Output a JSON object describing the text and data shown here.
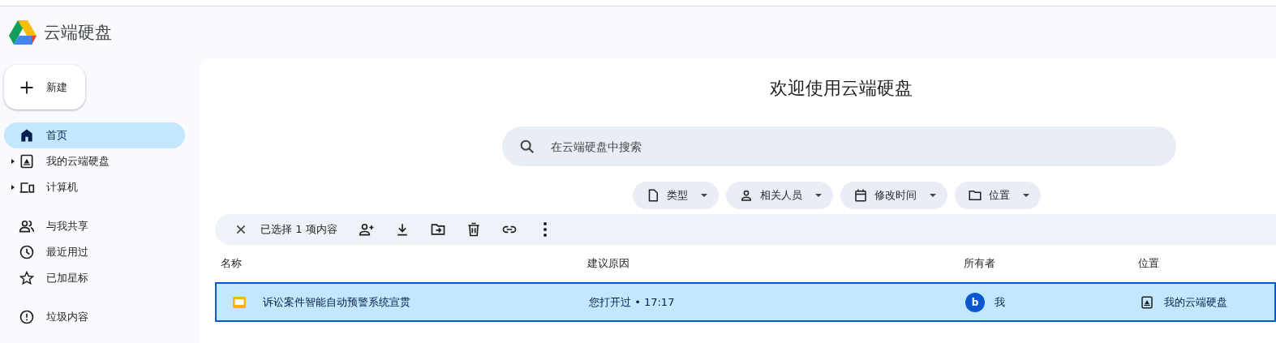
{
  "app": {
    "title": "云端硬盘"
  },
  "new_button": {
    "label": "新建"
  },
  "nav": [
    [
      {
        "label": "首页",
        "selected": true,
        "expandable": false
      },
      {
        "label": "我的云端硬盘",
        "selected": false,
        "expandable": true
      },
      {
        "label": "计算机",
        "selected": false,
        "expandable": true
      }
    ],
    [
      {
        "label": "与我共享",
        "selected": false,
        "expandable": false
      },
      {
        "label": "最近用过",
        "selected": false,
        "expandable": false
      },
      {
        "label": "已加星标",
        "selected": false,
        "expandable": false
      }
    ],
    [
      {
        "label": "垃圾内容",
        "selected": false,
        "expandable": false
      }
    ]
  ],
  "main": {
    "heading": "欢迎使用云端硬盘",
    "search": {
      "placeholder": "在云端硬盘中搜索"
    },
    "filters": [
      {
        "label": "类型"
      },
      {
        "label": "相关人员"
      },
      {
        "label": "修改时间"
      },
      {
        "label": "位置"
      }
    ],
    "selection_bar": {
      "text": "已选择 1 项内容"
    },
    "table": {
      "columns": [
        "名称",
        "建议原因",
        "所有者",
        "位置"
      ],
      "rows": [
        {
          "name": "诉讼案件智能自动预警系统宣贯",
          "reason": "您打开过 • 17:17",
          "owner_avatar": "b",
          "owner": "我",
          "location": "我的云端硬盘",
          "selected": true
        }
      ]
    }
  }
}
